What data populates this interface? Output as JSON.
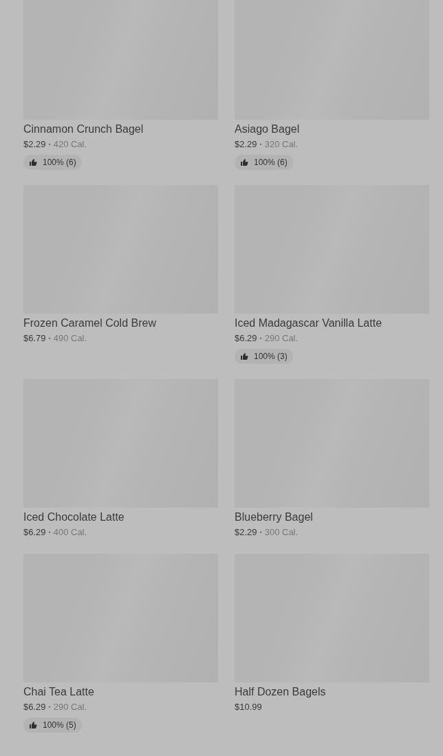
{
  "items": [
    {
      "name": "Cinnamon Crunch Bagel",
      "price": "$2.29",
      "separator": "•",
      "calories": "420 Cal.",
      "rating": "100% (6)"
    },
    {
      "name": "Asiago Bagel",
      "price": "$2.29",
      "separator": "•",
      "calories": "320 Cal.",
      "rating": "100% (6)"
    },
    {
      "name": "Frozen Caramel Cold Brew",
      "price": "$6.79",
      "separator": "•",
      "calories": "490 Cal."
    },
    {
      "name": "Iced Madagascar Vanilla Latte",
      "price": "$6.29",
      "separator": "•",
      "calories": "290 Cal.",
      "rating": "100% (3)"
    },
    {
      "name": "Iced Chocolate Latte",
      "price": "$6.29",
      "separator": "•",
      "calories": "400 Cal."
    },
    {
      "name": "Blueberry Bagel",
      "price": "$2.29",
      "separator": "•",
      "calories": "300 Cal."
    },
    {
      "name": "Chai Tea Latte",
      "price": "$6.29",
      "separator": "•",
      "calories": "290 Cal.",
      "rating": "100% (5)"
    },
    {
      "name": "Half Dozen Bagels",
      "price": "$10.99"
    }
  ]
}
